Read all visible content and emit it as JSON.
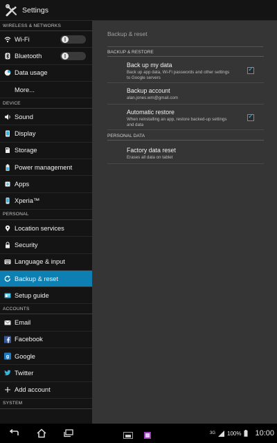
{
  "app": {
    "title": "Settings"
  },
  "sidebar": {
    "sections": [
      {
        "header": "WIRELESS & NETWORKS",
        "items": [
          {
            "label": "Wi-Fi",
            "icon": "wifi-icon",
            "toggle": "off"
          },
          {
            "label": "Bluetooth",
            "icon": "bluetooth-icon",
            "toggle": "off"
          },
          {
            "label": "Data usage",
            "icon": "data-usage-icon"
          },
          {
            "label": "More...",
            "icon": ""
          }
        ]
      },
      {
        "header": "DEVICE",
        "items": [
          {
            "label": "Sound",
            "icon": "sound-icon"
          },
          {
            "label": "Display",
            "icon": "display-icon"
          },
          {
            "label": "Storage",
            "icon": "storage-icon"
          },
          {
            "label": "Power management",
            "icon": "battery-icon"
          },
          {
            "label": "Apps",
            "icon": "apps-icon"
          },
          {
            "label": "Xperia™",
            "icon": "xperia-icon"
          }
        ]
      },
      {
        "header": "PERSONAL",
        "items": [
          {
            "label": "Location services",
            "icon": "location-icon"
          },
          {
            "label": "Security",
            "icon": "lock-icon"
          },
          {
            "label": "Language & input",
            "icon": "keyboard-icon"
          },
          {
            "label": "Backup & reset",
            "icon": "backup-icon",
            "active": true
          },
          {
            "label": "Setup guide",
            "icon": "setup-guide-icon"
          }
        ]
      },
      {
        "header": "ACCOUNTS",
        "items": [
          {
            "label": "Email",
            "icon": "email-icon"
          },
          {
            "label": "Facebook",
            "icon": "facebook-icon"
          },
          {
            "label": "Google",
            "icon": "google-icon"
          },
          {
            "label": "Twitter",
            "icon": "twitter-icon"
          },
          {
            "label": "Add account",
            "icon": "add-icon"
          }
        ]
      },
      {
        "header": "SYSTEM",
        "items": []
      }
    ]
  },
  "content": {
    "breadcrumb": "Backup & reset",
    "backup_restore_header": "BACKUP & RESTORE",
    "back_up_my_data": {
      "title": "Back up my data",
      "summary": "Back up app data, Wi-Fi passwords and other settings to Google servers",
      "checked": true
    },
    "backup_account": {
      "title": "Backup account",
      "summary": "alan.jones.wm@gmail.com"
    },
    "automatic_restore": {
      "title": "Automatic restore",
      "summary": "When reinstalling an app, restore backed-up settings and data",
      "checked": true
    },
    "personal_data_header": "PERSONAL DATA",
    "factory_reset": {
      "title": "Factory data reset",
      "summary": "Erases all data on tablet"
    }
  },
  "statusbar": {
    "network": "3G",
    "battery": "100%",
    "time": "10:00"
  },
  "colors": {
    "accent": "#0e7fb3",
    "check": "#33b5e5"
  }
}
